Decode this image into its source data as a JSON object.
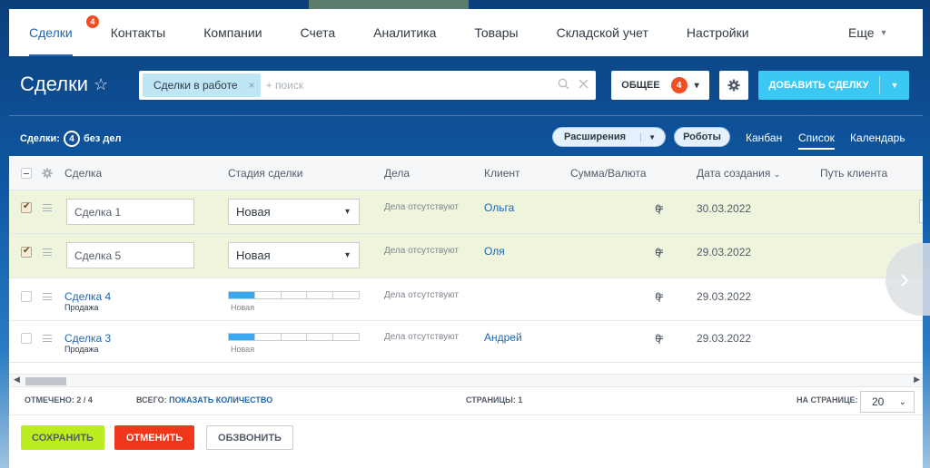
{
  "nav": {
    "items": [
      {
        "label": "Сделки",
        "badge": "4"
      },
      {
        "label": "Контакты"
      },
      {
        "label": "Компании"
      },
      {
        "label": "Счета"
      },
      {
        "label": "Аналитика"
      },
      {
        "label": "Товары"
      },
      {
        "label": "Складской учет"
      },
      {
        "label": "Настройки"
      }
    ],
    "more": "Еще"
  },
  "header": {
    "title": "Сделки",
    "filter_chip": "Сделки в работе",
    "search_placeholder": "+ поиск",
    "general_label": "ОБЩЕЕ",
    "general_count": "4",
    "add_label": "ДОБАВИТЬ СДЕЛКУ"
  },
  "toolbar": {
    "deals_label": "Сделки:",
    "deals_count": "4",
    "deals_suffix": "без дел",
    "extensions": "Расширения",
    "robots": "Роботы",
    "views": [
      "Канбан",
      "Список",
      "Календарь"
    ],
    "active_view": "Список"
  },
  "grid": {
    "columns": [
      "Сделка",
      "Стадия сделки",
      "Дела",
      "Клиент",
      "Сумма/Валюта",
      "Дата создания",
      "Путь клиента"
    ],
    "sort_column": "Дата создания",
    "rows": [
      {
        "name": "Сделка 1",
        "stage": "Новая",
        "tasks": "Дела отсутствуют",
        "client": "Ольга",
        "sum": "0",
        "currency": "〒",
        "date": "30.03.2022",
        "selected": true,
        "editing": true
      },
      {
        "name": "Сделка 5",
        "stage": "Новая",
        "tasks": "Дела отсутствуют",
        "client": "Оля",
        "sum": "0",
        "currency": "〒",
        "date": "29.03.2022",
        "selected": true,
        "editing": true
      },
      {
        "name": "Сделка 4",
        "sub": "Продажа",
        "stage": "Новая",
        "progress": 0.2,
        "tasks": "Дела отсутствуют",
        "client": "",
        "sum": "0",
        "currency": "〒",
        "date": "29.03.2022",
        "selected": false,
        "editing": false
      },
      {
        "name": "Сделка 3",
        "sub": "Продажа",
        "stage": "Новая",
        "progress": 0.2,
        "tasks": "Дела отсутствуют",
        "client": "Андрей",
        "sum": "0",
        "currency": "〒",
        "date": "29.03.2022",
        "selected": false,
        "editing": false
      }
    ]
  },
  "footer": {
    "checked_label": "ОТМЕЧЕНО: 2 / 4",
    "total_label": "ВСЕГО:",
    "total_link": "ПОКАЗАТЬ КОЛИЧЕСТВО",
    "pages_label": "СТРАНИЦЫ: 1",
    "per_page_label": "НА СТРАНИЦЕ:",
    "per_page_value": "20"
  },
  "actions": {
    "save": "СОХРАНИТЬ",
    "cancel": "ОТМЕНИТЬ",
    "call": "ОБЗВОНИТЬ"
  },
  "colors": {
    "accent": "#2067b0",
    "add_button": "#3bc8f5",
    "save_button": "#bbed21",
    "cancel_button": "#f0371b",
    "selected_row": "#eef5dc",
    "badge": "#f04e23"
  }
}
